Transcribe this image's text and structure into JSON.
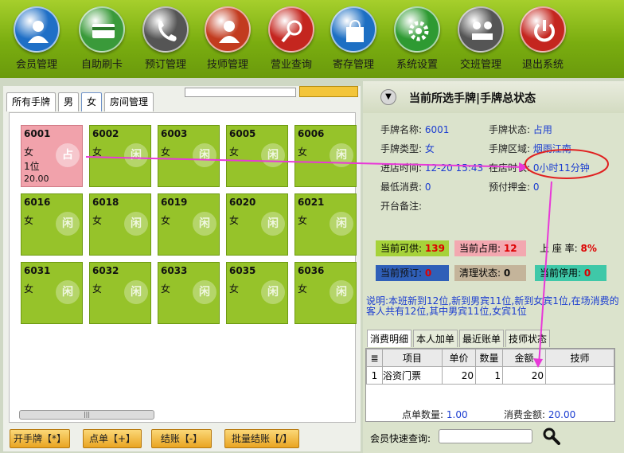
{
  "toolbar": [
    {
      "label": "会员管理",
      "icon": "member-icon",
      "color": "#1f6fc6"
    },
    {
      "label": "自助刷卡",
      "icon": "card-icon",
      "color": "#3a9a3a"
    },
    {
      "label": "预订管理",
      "icon": "phone-icon",
      "color": "#555555"
    },
    {
      "label": "技师管理",
      "icon": "technician-icon",
      "color": "#c23b1f"
    },
    {
      "label": "营业查询",
      "icon": "search-icon",
      "color": "#c4261f"
    },
    {
      "label": "寄存管理",
      "icon": "bag-icon",
      "color": "#1d6fc3"
    },
    {
      "label": "系统设置",
      "icon": "gear-icon",
      "color": "#2e9a32"
    },
    {
      "label": "交班管理",
      "icon": "handover-icon",
      "color": "#555555"
    },
    {
      "label": "退出系统",
      "icon": "power-icon",
      "color": "#c4261f"
    }
  ],
  "left": {
    "tabs": [
      "所有手牌",
      "男",
      "女",
      "房间管理"
    ],
    "cards": [
      {
        "num": "6001",
        "gender": "女",
        "seat": "1位",
        "amount": "20.00",
        "occupied": true,
        "mark": "占"
      },
      {
        "num": "6002",
        "gender": "女",
        "occupied": false,
        "mark": "闲"
      },
      {
        "num": "6003",
        "gender": "女",
        "occupied": false,
        "mark": "闲"
      },
      {
        "num": "6005",
        "gender": "女",
        "occupied": false,
        "mark": "闲"
      },
      {
        "num": "6006",
        "gender": "女",
        "occupied": false,
        "mark": "闲"
      },
      {
        "num": "6016",
        "gender": "女",
        "occupied": false,
        "mark": "闲"
      },
      {
        "num": "6018",
        "gender": "女",
        "occupied": false,
        "mark": "闲"
      },
      {
        "num": "6019",
        "gender": "女",
        "occupied": false,
        "mark": "闲"
      },
      {
        "num": "6020",
        "gender": "女",
        "occupied": false,
        "mark": "闲"
      },
      {
        "num": "6021",
        "gender": "女",
        "occupied": false,
        "mark": "闲"
      },
      {
        "num": "6031",
        "gender": "女",
        "occupied": false,
        "mark": "闲"
      },
      {
        "num": "6032",
        "gender": "女",
        "occupied": false,
        "mark": "闲"
      },
      {
        "num": "6033",
        "gender": "女",
        "occupied": false,
        "mark": "闲"
      },
      {
        "num": "6035",
        "gender": "女",
        "occupied": false,
        "mark": "闲"
      },
      {
        "num": "6036",
        "gender": "女",
        "occupied": false,
        "mark": "闲"
      }
    ],
    "scroll_label": "|||",
    "buttons": [
      "开手牌【*】",
      "点单【+】",
      "结账【-】",
      "批量结账【/】"
    ]
  },
  "right": {
    "title": "当前所选手牌|手牌总状态",
    "name_label": "手牌名称:",
    "name_value": "6001",
    "status_label": "手牌状态:",
    "status_value": "占用",
    "type_label": "手牌类型:",
    "type_value": "女",
    "area_label": "手牌区域:",
    "area_value": "烟雨江南",
    "enter_label": "进店时间:",
    "enter_value": "12-20 15:43",
    "stay_label": "在店时长:",
    "stay_value": "0小时11分钟",
    "min_label": "最低消费:",
    "min_value": "0",
    "deposit_label": "预付押金:",
    "deposit_value": "0",
    "note_label": "开台备注:",
    "stats": {
      "available_label": "当前可供:",
      "available_value": "139",
      "occupied_label": "当前占用:",
      "occupied_value": "12",
      "rate_label": "上 座 率:",
      "rate_value": "8%",
      "reserved_label": "当前预订:",
      "reserved_value": "0",
      "cleaning_label": "清理状态:",
      "cleaning_value": "0",
      "stopped_label": "当前停用:",
      "stopped_value": "0"
    },
    "description": "说明:本班新到12位,新到男宾11位,新到女宾1位,在场消费的客人共有12位,其中男宾11位,女宾1位",
    "bottom_tabs": [
      "消费明细",
      "本人加单",
      "最近账单",
      "技师状态"
    ],
    "table": {
      "headers": [
        "项目",
        "单价",
        "数量",
        "金额",
        "技师"
      ],
      "rows": [
        {
          "idx": "1",
          "item": "浴资门票",
          "price": "20",
          "qty": "1",
          "amount": "20",
          "tech": ""
        }
      ]
    },
    "order_count_label": "点单数量:",
    "order_count_value": "1.00",
    "total_label": "消费金额:",
    "total_value": "20.00",
    "quick_query_label": "会员快速查询:"
  }
}
